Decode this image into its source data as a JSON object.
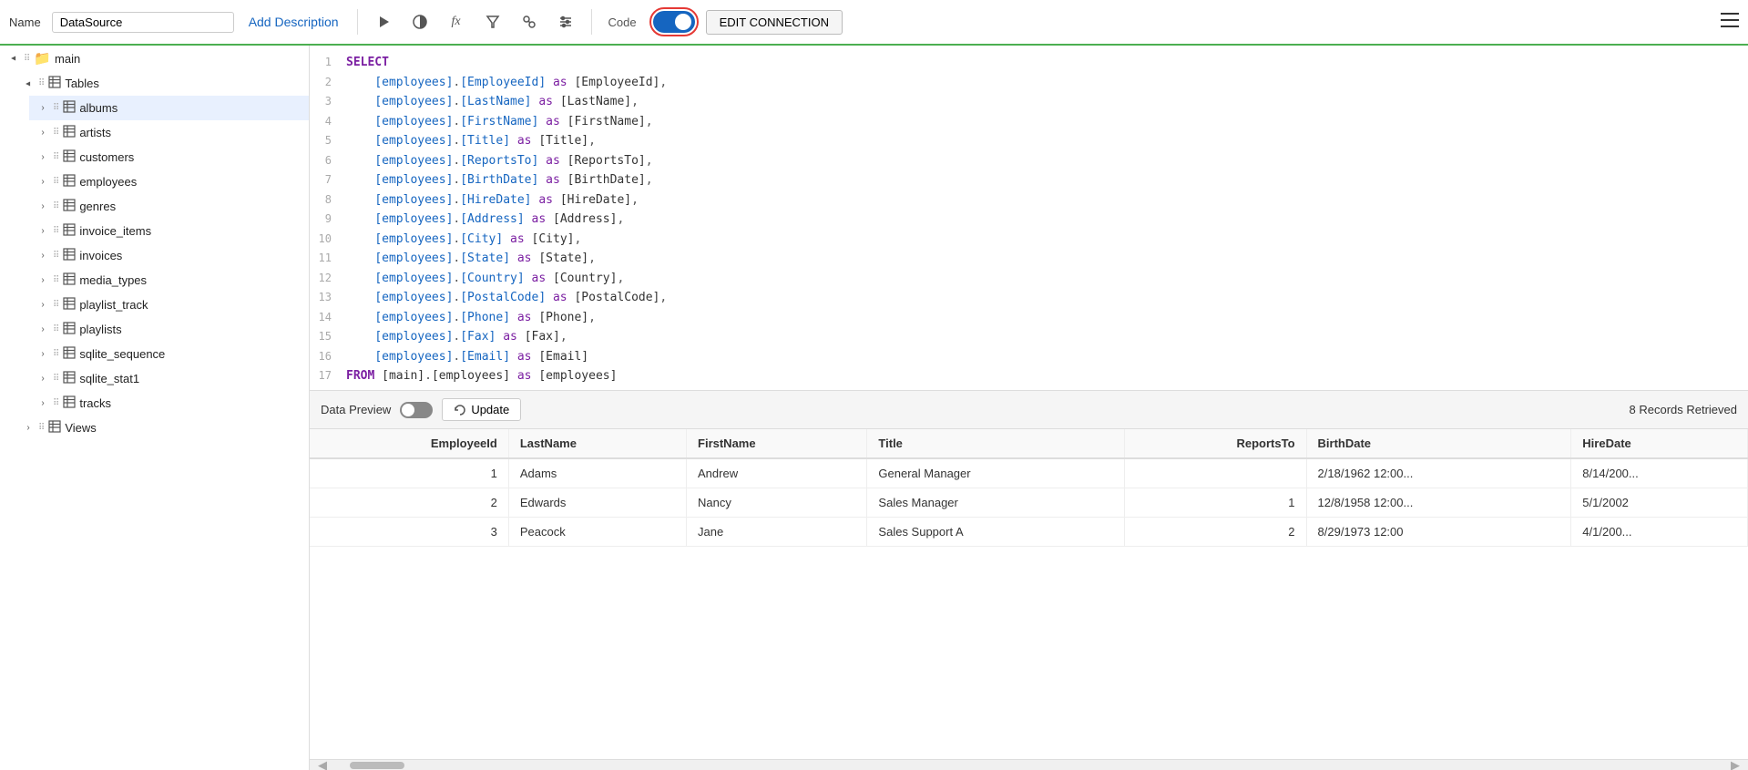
{
  "topbar": {
    "name_label": "Name",
    "name_value": "DataSource",
    "add_description": "Add Description",
    "code_label": "Code",
    "edit_connection": "EDIT CONNECTION",
    "toggle_on": true
  },
  "sidebar": {
    "sections": [
      {
        "id": "main",
        "label": "main",
        "type": "folder",
        "expanded": true,
        "indent": 0,
        "children": [
          {
            "id": "tables",
            "label": "Tables",
            "type": "group",
            "expanded": true,
            "indent": 1,
            "children": [
              {
                "id": "albums",
                "label": "albums",
                "type": "table",
                "indent": 2,
                "selected": true
              },
              {
                "id": "artists",
                "label": "artists",
                "type": "table",
                "indent": 2
              },
              {
                "id": "customers",
                "label": "customers",
                "type": "table",
                "indent": 2
              },
              {
                "id": "employees",
                "label": "employees",
                "type": "table",
                "indent": 2
              },
              {
                "id": "genres",
                "label": "genres",
                "type": "table",
                "indent": 2
              },
              {
                "id": "invoice_items",
                "label": "invoice_items",
                "type": "table",
                "indent": 2
              },
              {
                "id": "invoices",
                "label": "invoices",
                "type": "table",
                "indent": 2
              },
              {
                "id": "media_types",
                "label": "media_types",
                "type": "table",
                "indent": 2
              },
              {
                "id": "playlist_track",
                "label": "playlist_track",
                "type": "table",
                "indent": 2
              },
              {
                "id": "playlists",
                "label": "playlists",
                "type": "table",
                "indent": 2
              },
              {
                "id": "sqlite_sequence",
                "label": "sqlite_sequence",
                "type": "table",
                "indent": 2
              },
              {
                "id": "sqlite_stat1",
                "label": "sqlite_stat1",
                "type": "table",
                "indent": 2
              },
              {
                "id": "tracks",
                "label": "tracks",
                "type": "table",
                "indent": 2
              }
            ]
          },
          {
            "id": "views",
            "label": "Views",
            "type": "group",
            "expanded": false,
            "indent": 1
          }
        ]
      }
    ]
  },
  "editor": {
    "lines": [
      {
        "num": 1,
        "content": "SELECT",
        "type": "keyword"
      },
      {
        "num": 2,
        "content": "    [employees].[EmployeeId] as [EmployeeId],",
        "type": "code"
      },
      {
        "num": 3,
        "content": "    [employees].[LastName] as [LastName],",
        "type": "code"
      },
      {
        "num": 4,
        "content": "    [employees].[FirstName] as [FirstName],",
        "type": "code"
      },
      {
        "num": 5,
        "content": "    [employees].[Title] as [Title],",
        "type": "code"
      },
      {
        "num": 6,
        "content": "    [employees].[ReportsTo] as [ReportsTo],",
        "type": "code"
      },
      {
        "num": 7,
        "content": "    [employees].[BirthDate] as [BirthDate],",
        "type": "code"
      },
      {
        "num": 8,
        "content": "    [employees].[HireDate] as [HireDate],",
        "type": "code"
      },
      {
        "num": 9,
        "content": "    [employees].[Address] as [Address],",
        "type": "code"
      },
      {
        "num": 10,
        "content": "    [employees].[City] as [City],",
        "type": "code"
      },
      {
        "num": 11,
        "content": "    [employees].[State] as [State],",
        "type": "code"
      },
      {
        "num": 12,
        "content": "    [employees].[Country] as [Country],",
        "type": "code"
      },
      {
        "num": 13,
        "content": "    [employees].[PostalCode] as [PostalCode],",
        "type": "code"
      },
      {
        "num": 14,
        "content": "    [employees].[Phone] as [Phone],",
        "type": "code"
      },
      {
        "num": 15,
        "content": "    [employees].[Fax] as [Fax],",
        "type": "code"
      },
      {
        "num": 16,
        "content": "    [employees].[Email] as [Email]",
        "type": "code"
      },
      {
        "num": 17,
        "content": "FROM [main].[employees] as [employees]",
        "type": "from"
      }
    ]
  },
  "preview": {
    "label": "Data Preview",
    "update_label": "Update",
    "records_text": "8 Records Retrieved",
    "columns": [
      "EmployeeId",
      "LastName",
      "FirstName",
      "Title",
      "ReportsTo",
      "BirthDate",
      "HireDate"
    ],
    "rows": [
      {
        "EmployeeId": "1",
        "LastName": "Adams",
        "FirstName": "Andrew",
        "Title": "General Manager",
        "ReportsTo": "",
        "BirthDate": "2/18/1962 12:00...",
        "HireDate": "8/14/200..."
      },
      {
        "EmployeeId": "2",
        "LastName": "Edwards",
        "FirstName": "Nancy",
        "Title": "Sales Manager",
        "ReportsTo": "1",
        "BirthDate": "12/8/1958 12:00...",
        "HireDate": "5/1/2002"
      },
      {
        "EmployeeId": "3",
        "LastName": "Peacock",
        "FirstName": "Jane",
        "Title": "Sales Support A",
        "ReportsTo": "2",
        "BirthDate": "8/29/1973 12:00",
        "HireDate": "4/1/200..."
      }
    ]
  },
  "icons": {
    "chevron_right": "›",
    "chevron_down": "⌄",
    "folder": "📁",
    "table_grid": "⊞",
    "play": "▶",
    "circle_half": "◑",
    "fx": "fx",
    "filter": "⊿",
    "user_arrows": "⇅",
    "sliders": "⊟",
    "hamburger": "☰",
    "refresh": "↻"
  }
}
